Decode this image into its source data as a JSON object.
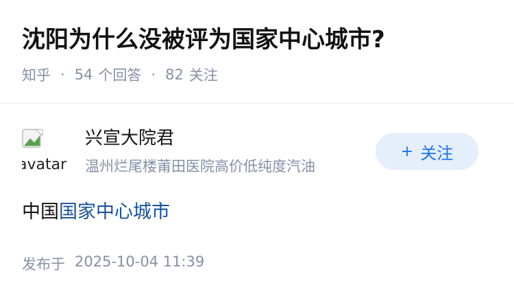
{
  "question": {
    "title": "沈阳为什么没被评为国家中心城市?",
    "source": "知乎",
    "answers_count": "54",
    "answers_label": "个回答",
    "followers_count": "82",
    "followers_label": "关注"
  },
  "author": {
    "avatar_alt": "avatar",
    "name": "兴宣大院君",
    "bio": "温州烂尾楼莆田医院高价低纯度汽油",
    "follow_button": {
      "icon": "plus-icon",
      "label": "关注"
    }
  },
  "answer": {
    "prefix": "中国",
    "link_text": "国家中心城市"
  },
  "publish": {
    "label": "发布于",
    "timestamp": "2025-10-04 11:39"
  },
  "colors": {
    "meta_gray": "#8590a6",
    "link_blue": "#175199",
    "button_bg": "#e5eefb",
    "button_text": "#1772f6"
  }
}
